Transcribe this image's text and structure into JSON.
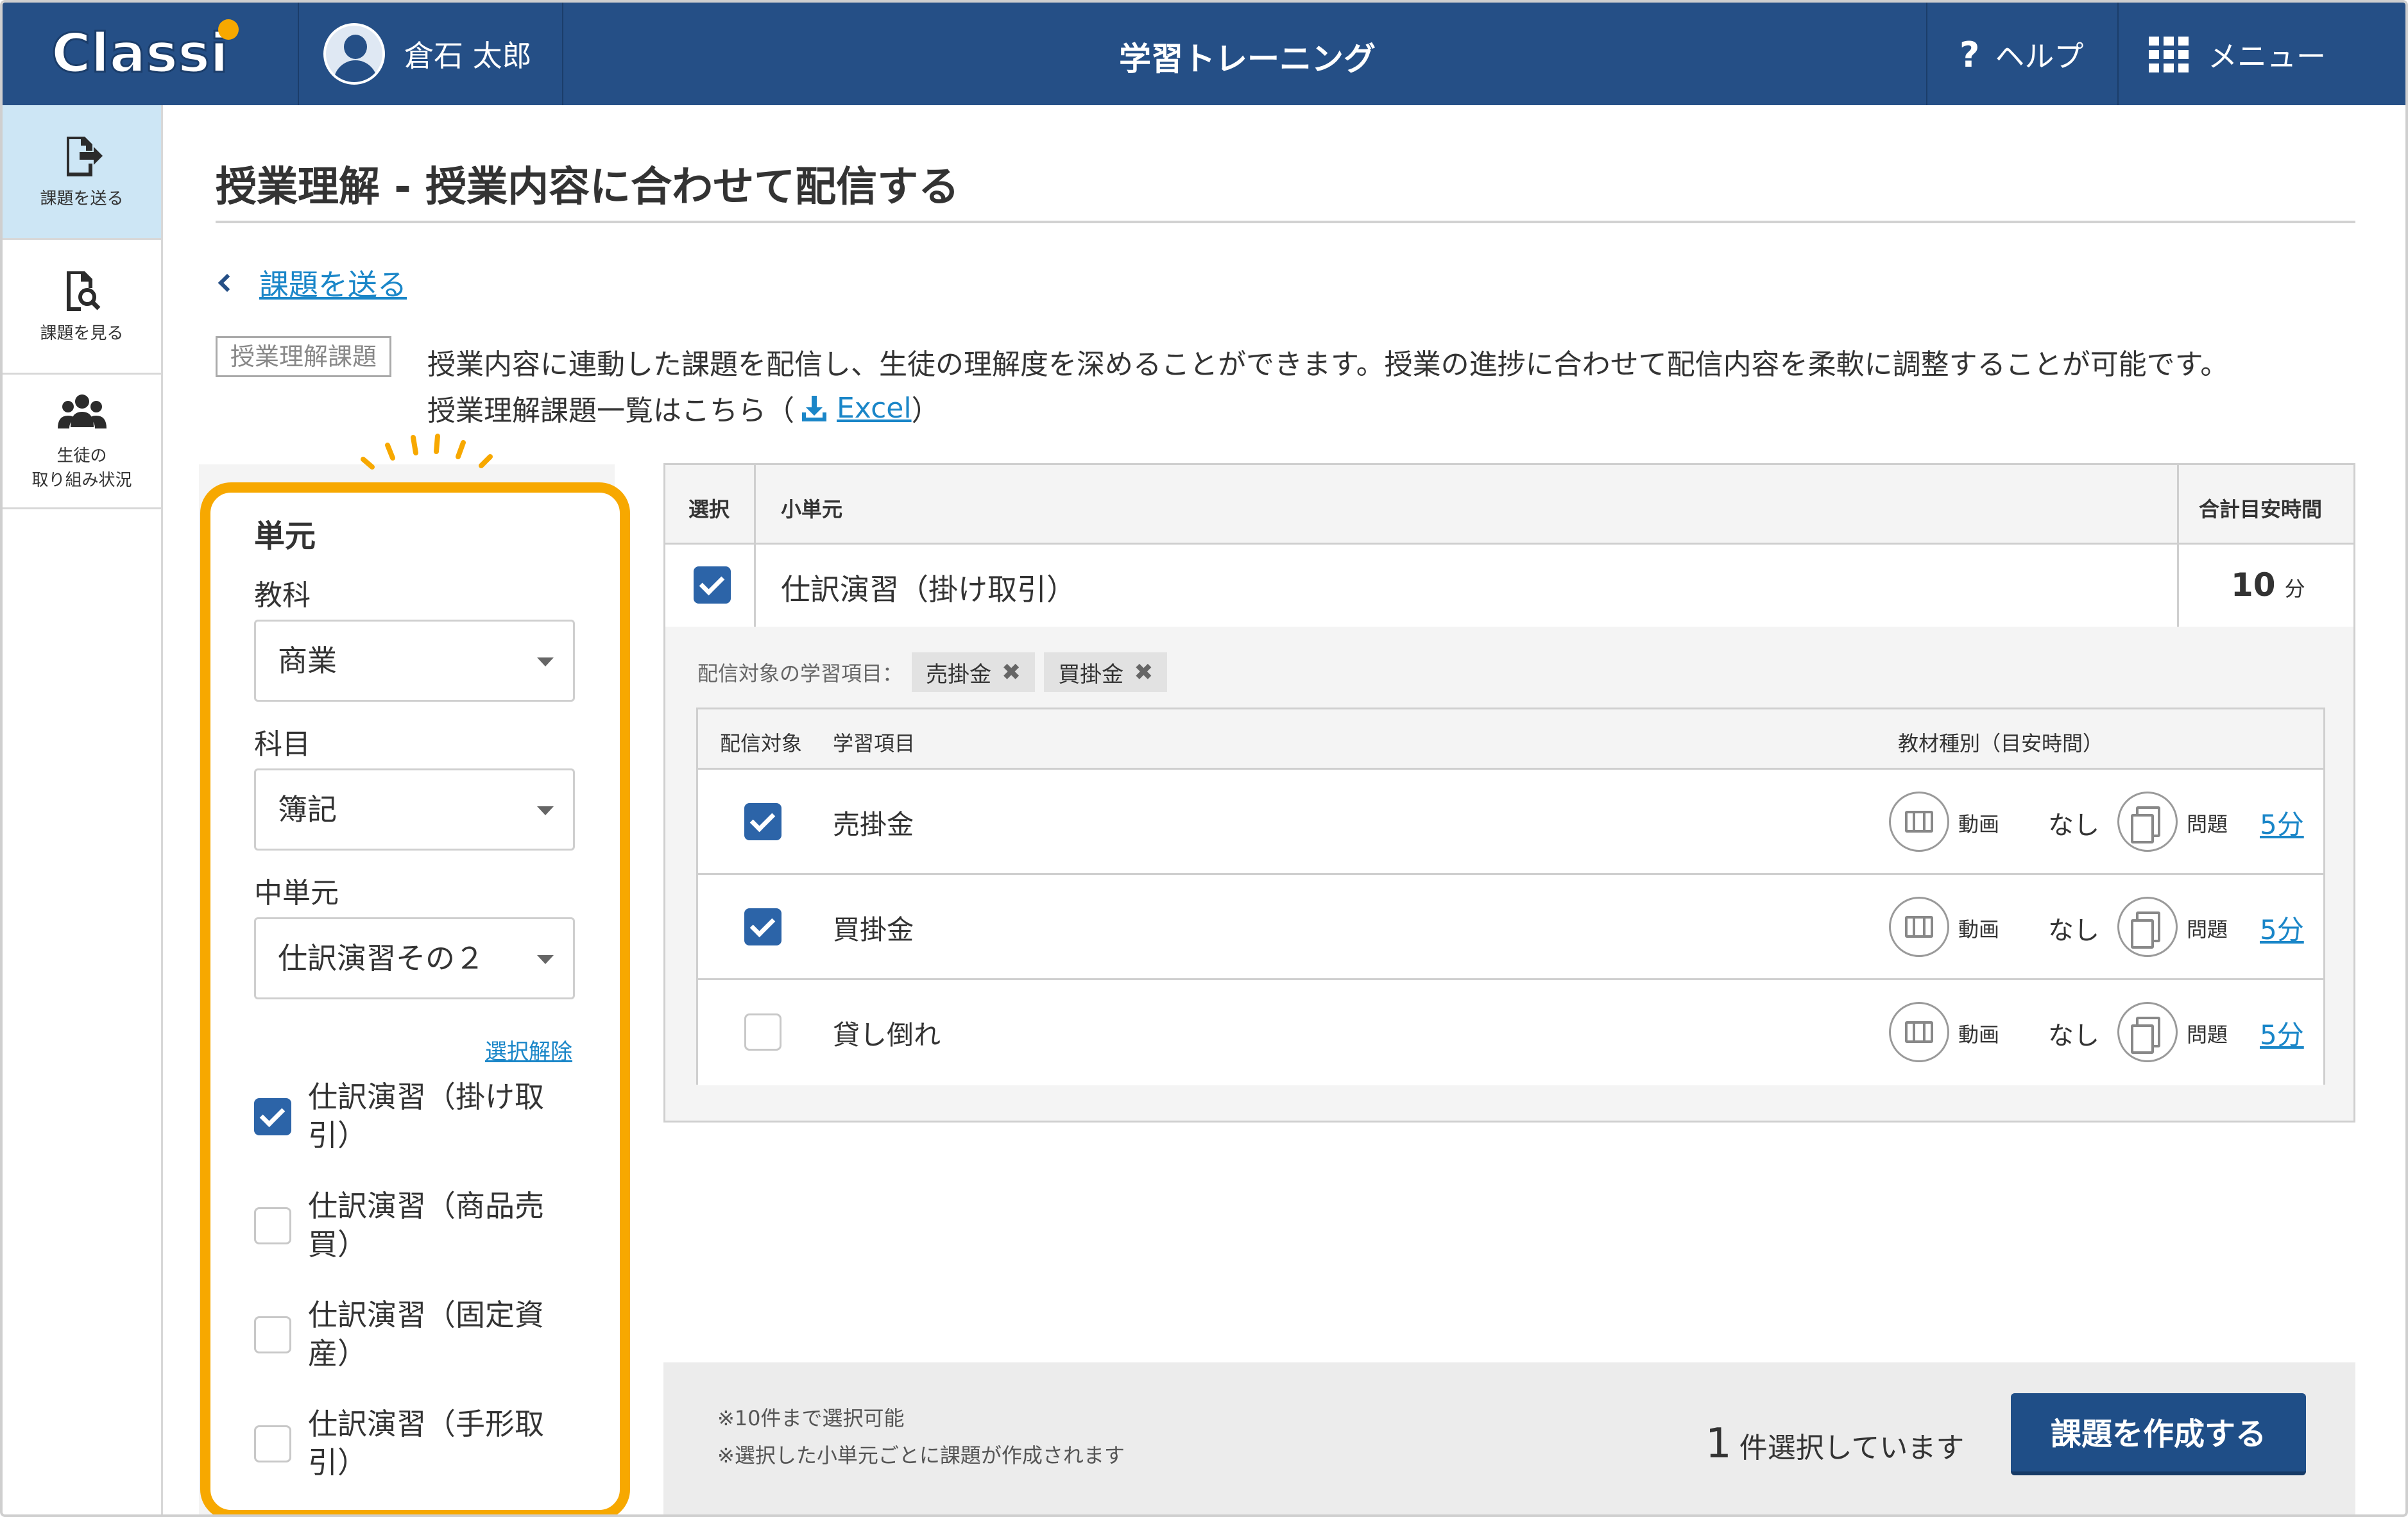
{
  "header": {
    "logo_text": "Classi",
    "user_name": "倉石 太郎",
    "app_title": "学習トレーニング",
    "help_label": "ヘルプ",
    "menu_label": "メニュー"
  },
  "sidebar": {
    "items": [
      {
        "label": "課題を送る",
        "icon": "send-assignment-icon",
        "active": true
      },
      {
        "label": "課題を見る",
        "icon": "view-assignment-icon",
        "active": false
      },
      {
        "label_line1": "生徒の",
        "label_line2": "取り組み状況",
        "icon": "students-icon",
        "active": false
      }
    ]
  },
  "page": {
    "title": "授業理解 - 授業内容に合わせて配信する",
    "back_link": "課題を送る",
    "tag": "授業理解課題",
    "description_line1": "授業内容に連動した課題を配信し、生徒の理解度を深めることができます。授業の進捗に合わせて配信内容を柔軟に調整することが可能です。",
    "description_line2_prefix": "授業理解課題一覧はこちら（",
    "excel_link": "Excel",
    "description_line2_suffix": "）"
  },
  "filter": {
    "title": "単元",
    "subject_label": "教科",
    "subject_value": "商業",
    "course_label": "科目",
    "course_value": "簿記",
    "middle_unit_label": "中単元",
    "middle_unit_value": "仕訳演習その２",
    "clear_label": "選択解除",
    "units": [
      {
        "line1": "仕訳演習（掛け取",
        "line2": "引）",
        "checked": true
      },
      {
        "line1": "仕訳演習（商品売",
        "line2": "買）",
        "checked": false
      },
      {
        "line1": "仕訳演習（固定資",
        "line2": "産）",
        "checked": false
      },
      {
        "line1": "仕訳演習（手形取",
        "line2": "引）",
        "checked": false
      }
    ]
  },
  "table": {
    "headers": {
      "select": "選択",
      "subunit": "小単元",
      "total_time": "合計目安時間"
    },
    "row": {
      "name": "仕訳演習（掛け取引）",
      "minutes": "10",
      "minutes_unit": "分",
      "checked": true
    },
    "targets_label": "配信対象の学習項目：",
    "target_chips": [
      "売掛金",
      "買掛金"
    ],
    "chip_remove": "✖",
    "inner_headers": {
      "target": "配信対象",
      "item": "学習項目",
      "material": "教材種別（目安時間）"
    },
    "items": [
      {
        "name": "売掛金",
        "checked": true,
        "video_label": "動画",
        "video_value": "なし",
        "problem_label": "問題",
        "problem_value": "5分"
      },
      {
        "name": "買掛金",
        "checked": true,
        "video_label": "動画",
        "video_value": "なし",
        "problem_label": "問題",
        "problem_value": "5分"
      },
      {
        "name": "貸し倒れ",
        "checked": false,
        "video_label": "動画",
        "video_value": "なし",
        "problem_label": "問題",
        "problem_value": "5分"
      }
    ]
  },
  "footer": {
    "note1": "※10件まで選択可能",
    "note2": "※選択した小単元ごとに課題が作成されます",
    "count": "1",
    "count_suffix": "件選択しています",
    "create_button": "課題を作成する"
  },
  "colors": {
    "header_bg": "#254f86",
    "accent_orange": "#f7a800",
    "link": "#1a86c8",
    "checkbox": "#2c64a8",
    "sidebar_active": "#cde6f5"
  }
}
